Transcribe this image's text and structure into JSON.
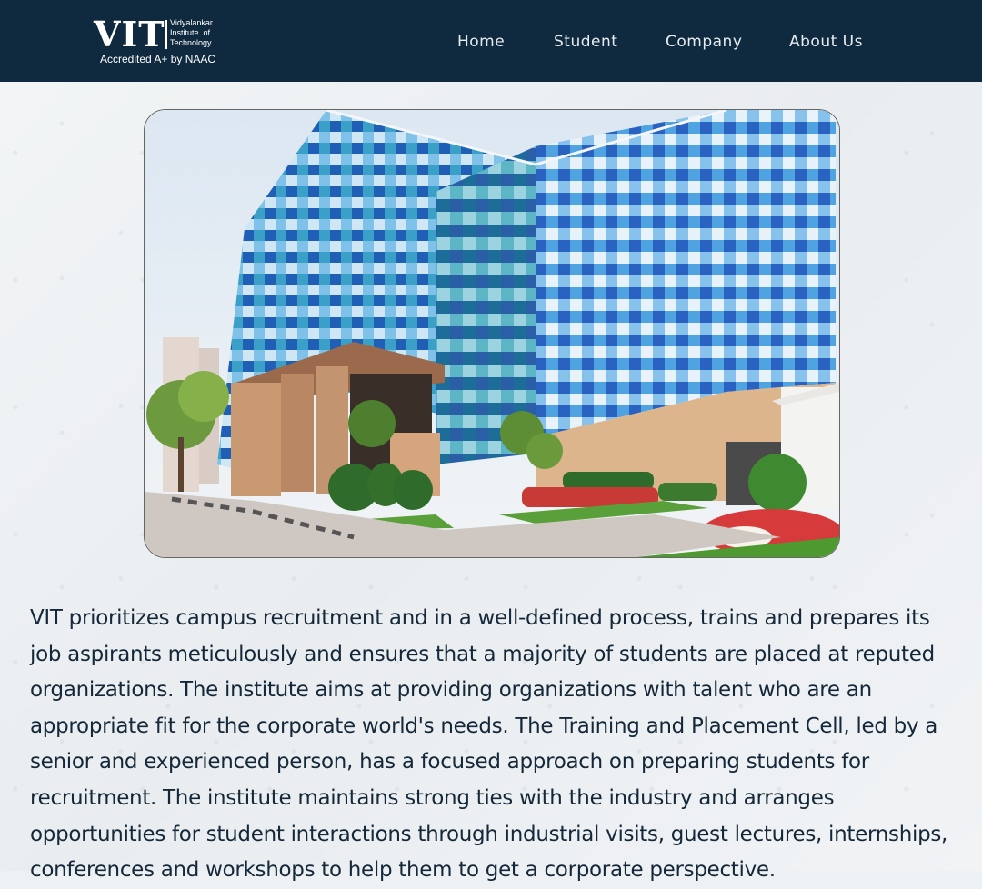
{
  "brand": {
    "logo_text": "VIT",
    "name_line1": "Vidyalankar",
    "name_line2": "Institute  of",
    "name_line3": "Technology",
    "accreditation": "Accredited A+ by NAAC"
  },
  "nav": {
    "items": [
      {
        "label": "Home"
      },
      {
        "label": "Student"
      },
      {
        "label": "Company"
      },
      {
        "label": "About Us"
      }
    ]
  },
  "hero": {
    "icon": "campus-building-photo"
  },
  "main": {
    "description": "VIT prioritizes campus recruitment and in a well-defined process, trains and prepares its job aspirants meticulously and ensures that a majority of students are placed at reputed organizations. The institute aims at providing organizations with talent who are an appropriate fit for the corporate world's needs. The Training and Placement Cell, led by a senior and experienced person, has a focused approach on preparing students for recruitment. The institute maintains strong ties with the industry and arranges opportunities for student interactions through industrial visits, guest lectures, internships, conferences and workshops to help them to get a corporate perspective."
  },
  "colors": {
    "navbar_bg": "#0f2a3e",
    "nav_text": "#e7ecf0",
    "body_text": "#14283a",
    "page_bg": "#eef1f3"
  }
}
